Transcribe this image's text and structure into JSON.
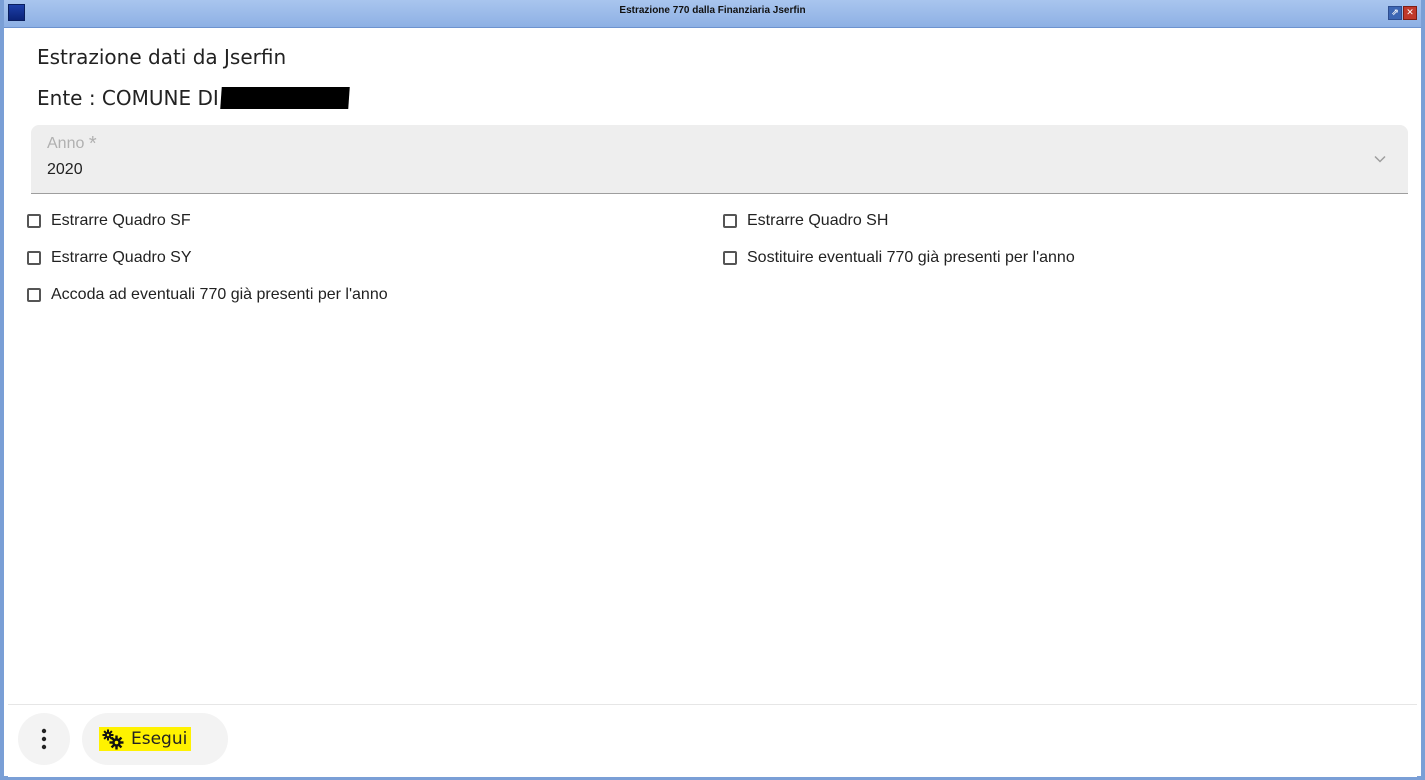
{
  "window": {
    "title": "Estrazione 770 dalla Finanziaria Jserfin",
    "restore_glyph": "⇗",
    "close_glyph": "✕"
  },
  "header": {
    "title": "Estrazione dati da Jserfin",
    "ente_label": "Ente : COMUNE DI"
  },
  "anno_field": {
    "label": "Anno",
    "required_mark": "*",
    "value": "2020",
    "icon": "chevron-down-icon"
  },
  "options": [
    {
      "label": "Estrarre Quadro SF",
      "checked": false
    },
    {
      "label": "Estrarre Quadro SH",
      "checked": false
    },
    {
      "label": "Estrarre Quadro SY",
      "checked": false
    },
    {
      "label": "Sostituire eventuali 770 già presenti per l'anno",
      "checked": false
    },
    {
      "label": "Accoda ad eventuali 770 già presenti per l'anno",
      "checked": false
    }
  ],
  "footer": {
    "more_icon": "more-vertical-icon",
    "run_label": "Esegui",
    "run_icon": "gears-icon",
    "run_highlight": "#fff200"
  },
  "colors": {
    "titlebar": "#8db0e4",
    "window_border": "#7a9fd6",
    "field_bg": "#eeeeee"
  }
}
